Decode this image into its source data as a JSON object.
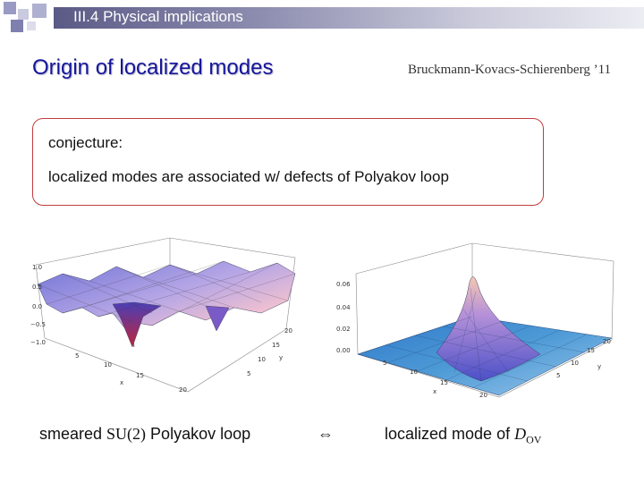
{
  "header": {
    "section": "III.4 Physical implications"
  },
  "slide": {
    "title": "Origin of localized modes",
    "citation": "Bruckmann-Kovacs-Schierenberg ’11"
  },
  "box": {
    "label": "conjecture:",
    "text": "localized modes are associated w/ defects of Polyakov loop"
  },
  "left_plot": {
    "z_ticks": [
      "1.0",
      "0.5",
      "0.0",
      "−0.5",
      "−1.0"
    ],
    "x_ticks": [
      "5",
      "10",
      "15",
      "20"
    ],
    "y_ticks": [
      "5",
      "10",
      "15",
      "20"
    ],
    "x_label": "x",
    "y_label": "y"
  },
  "right_plot": {
    "z_ticks": [
      "0.06",
      "0.04",
      "0.02",
      "0.00"
    ],
    "x_ticks": [
      "5",
      "10",
      "15",
      "20"
    ],
    "y_ticks": [
      "5",
      "10",
      "15",
      "20"
    ],
    "x_label": "x",
    "y_label": "y"
  },
  "captions": {
    "left_pre": "smeared ",
    "left_math": "SU(2)",
    "left_post": " Polyakov loop",
    "arrow": "⇔",
    "right_pre": "localized mode of ",
    "right_math": "D",
    "right_sub": "OV"
  }
}
